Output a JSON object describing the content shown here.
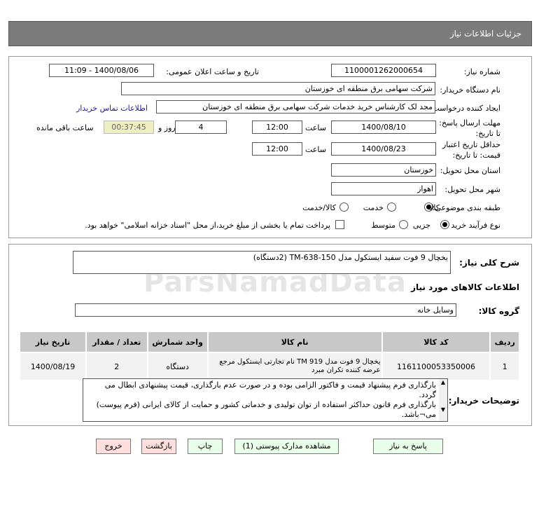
{
  "header": {
    "title": "جزئیات اطلاعات نیاز"
  },
  "form": {
    "need_number_label": "شماره نیاز:",
    "need_number": "1100001262000654",
    "announce_label": "تاریخ و ساعت اعلان عمومی:",
    "announce_value": "1400/08/06 - 11:09",
    "buyer_label": "نام دستگاه خریدار:",
    "buyer": "شرکت سهامی برق منطقه ای خوزستان",
    "creator_label": "ایجاد کننده درخواست:",
    "creator": "مجد لک کارشناس خرید خدمات شرکت سهامی برق منطقه ای خوزستان",
    "contact_link": "اطلاعات تماس خریدار",
    "deadline_label": "مهلت ارسال پاسخ: تا تاریخ:",
    "deadline_date": "1400/08/10",
    "time_label": "ساعت",
    "deadline_time": "12:00",
    "days": "4",
    "days_label": "روز و",
    "remaining": "00:37:45",
    "remaining_label": "ساعت باقی مانده",
    "validity_label": "حداقل تاریخ اعتبار قیمت: تا تاریخ:",
    "validity_date": "1400/08/23",
    "validity_time": "12:00",
    "province_label": "استان محل تحویل:",
    "province": "خوزستان",
    "city_label": "شهر محل تحویل:",
    "city": "اهواز",
    "category_label": "طبقه بندی موضوعی:",
    "category_options": [
      "کالا",
      "خدمت",
      "کالا/خدمت"
    ],
    "category_selected": "کالا",
    "process_label": "نوع فرآیند خرید :",
    "process_options": [
      "جزیی",
      "متوسط"
    ],
    "process_selected": "جزیی",
    "payment_note": "پرداخت تمام یا بخشی از مبلغ خرید،از محل \"اسناد خزانه اسلامی\" خواهد بود."
  },
  "details": {
    "summary_label": "شرح کلی نیاز:",
    "summary": "یخچال 9 فوت سفید ایستکول مدل TM-638-150 (2دستگاه)",
    "goods_info_title": "اطلاعات کالاهای مورد نیاز",
    "group_label": "گروه کالا:",
    "group": "وسایل خانه",
    "table": {
      "headers": [
        "ردیف",
        "کد کالا",
        "نام کالا",
        "واحد شمارش",
        "تعداد / مقدار",
        "تاریخ نیاز"
      ],
      "rows": [
        [
          "1",
          "1161100053350006",
          "یخچال 9 فوت مدل TM 919 نام تجارتی ایستکول مرجع عرضه کننده تکران مبرد",
          "دستگاه",
          "2",
          "1400/08/19"
        ]
      ]
    },
    "notes_label": "توضیحات خریدار:",
    "notes": "بارگذاری فرم پیشنهاد قیمت و فاکتور الزامی بوده و در صورت عدم بارگذاری، قیمت پیشنهادی ابطال می گردد.\nبارگذاری فرم قانون حداکثر استفاده از توان تولیدی و خدماتی کشور و حمایت از کالای ایرانی (فرم پیوست) می¬باشد."
  },
  "buttons": {
    "reply": "پاسخ به نیاز",
    "attachments": "مشاهده مدارک پیوستی (1)",
    "print": "چاپ",
    "back": "بازگشت",
    "exit": "خروج"
  },
  "watermark": "ParsNamadData"
}
